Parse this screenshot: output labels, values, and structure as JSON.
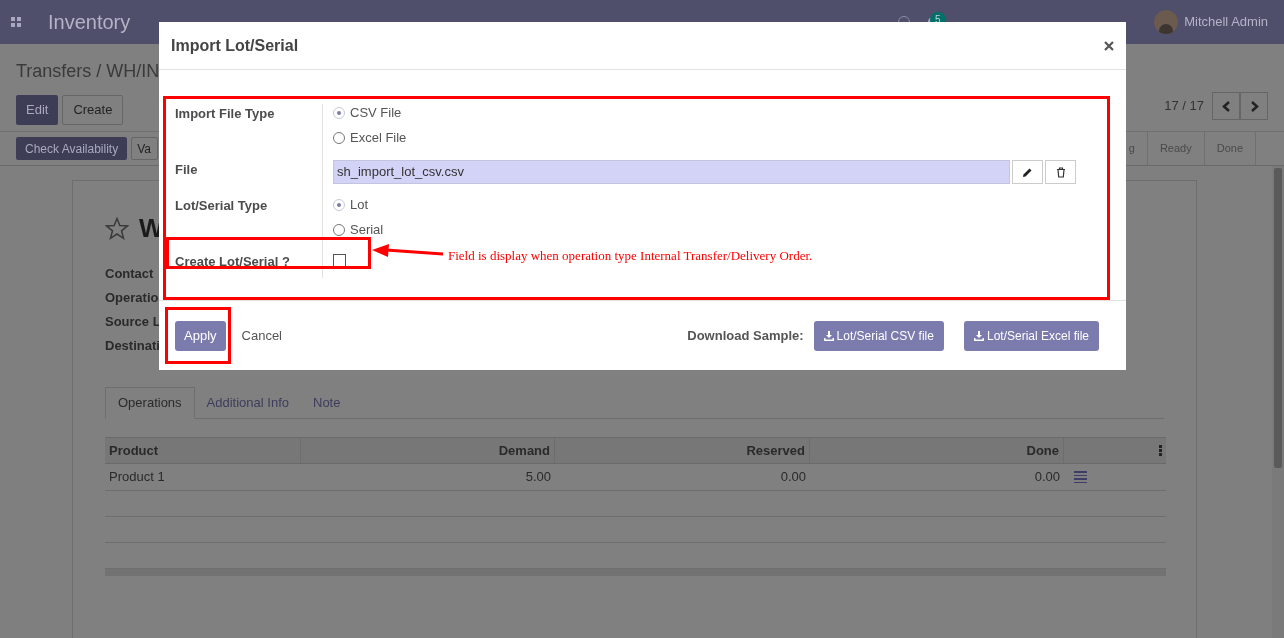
{
  "navbar": {
    "app_title": "Inventory",
    "chat_count": "5",
    "user": "Mitchell Admin"
  },
  "control_panel": {
    "breadcrumb": "Transfers / WH/IN",
    "buttons": [
      "Edit",
      "Create"
    ],
    "pager": "17 / 17"
  },
  "status_bar": {
    "actions": [
      "Check Availability",
      "Va"
    ],
    "stages": [
      {
        "label": "g",
        "selected": false
      },
      {
        "label": "Ready",
        "selected": false
      },
      {
        "label": "Done",
        "selected": false
      }
    ]
  },
  "record": {
    "title": "W",
    "fields": [
      "Contact",
      "Operatio",
      "Source L",
      "Destinati"
    ]
  },
  "tabs": [
    {
      "label": "Operations",
      "selected": true
    },
    {
      "label": "Additional Info",
      "selected": false
    },
    {
      "label": "Note",
      "selected": false
    }
  ],
  "table": {
    "columns": [
      "Product",
      "Demand",
      "Reserved",
      "Done"
    ],
    "rows": [
      [
        "Product 1",
        "5.00",
        "0.00",
        "0.00"
      ]
    ]
  },
  "dialog": {
    "title": "Import Lot/Serial",
    "fields": [
      {
        "kind": "radio",
        "label": "Import File Type",
        "options": [
          {
            "label": "CSV File",
            "selected": true
          },
          {
            "label": "Excel File",
            "selected": false
          }
        ]
      },
      {
        "kind": "file",
        "label": "File",
        "value": "sh_import_lot_csv.csv"
      },
      {
        "kind": "radio",
        "label": "Lot/Serial Type",
        "options": [
          {
            "label": "Lot",
            "selected": true
          },
          {
            "label": "Serial",
            "selected": false
          }
        ]
      },
      {
        "kind": "checkbox",
        "label": "Create Lot/Serial ?",
        "checked": false
      }
    ],
    "apply": "Apply",
    "cancel": "Cancel",
    "download_label": "Download Sample:",
    "download_buttons": [
      "Lot/Serial CSV file",
      "Lot/Serial Excel file"
    ]
  },
  "annotation": {
    "note": "Field is display when operation type Internal Transfer/Delivery Order."
  }
}
